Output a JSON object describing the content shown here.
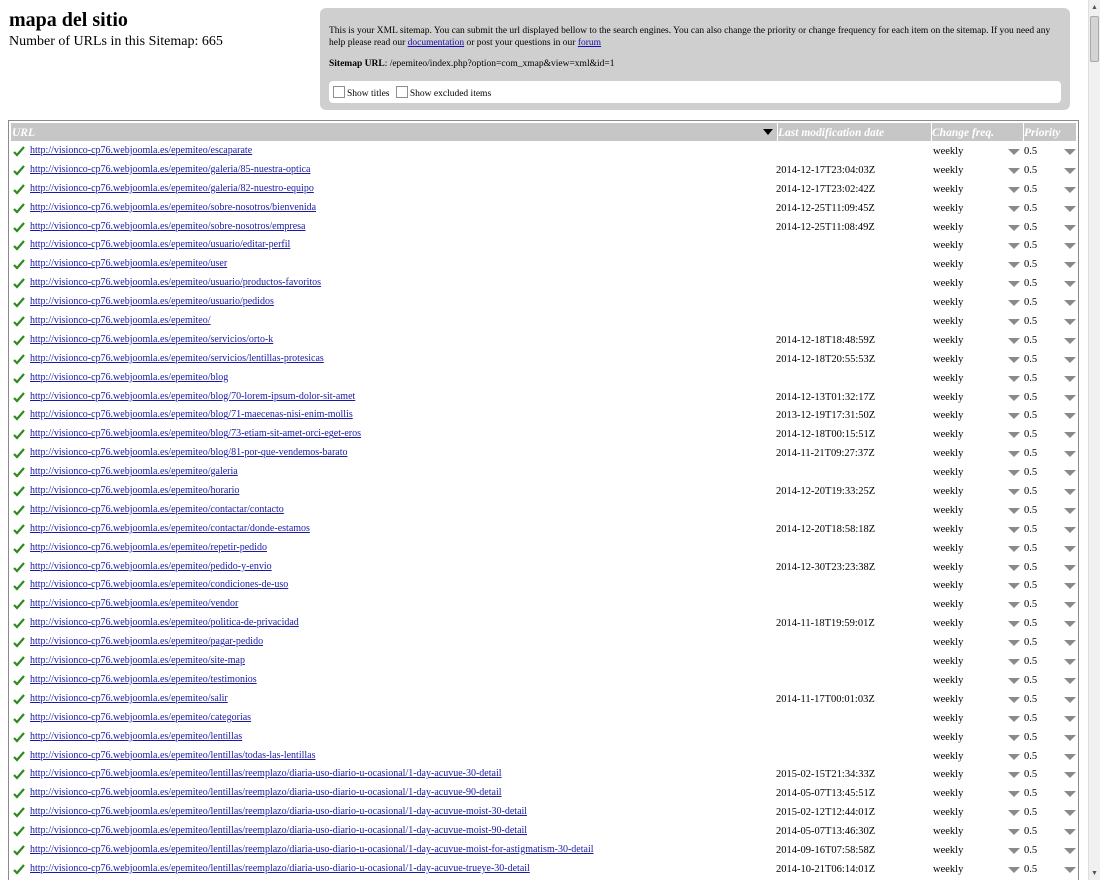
{
  "page": {
    "title": "mapa del sitio",
    "url_count_text": "Number of URLs in this Sitemap: 665"
  },
  "info": {
    "text_before_doc": "This is your XML sitemap. You can submit the url displayed bellow to the search engines. You can also change the priority or change frequency for each item on the sitemap. If you need any help please read our ",
    "documentation_link": "documentation",
    "text_between": " or post your questions in our ",
    "forum_link": "forum",
    "sitemap_url_label": "Sitemap URL",
    "sitemap_url_value": ": /epemiteo/index.php?option=com_xmap&view=xml&id=1",
    "show_titles_label": "Show titles",
    "show_excluded_label": "Show excluded items"
  },
  "table": {
    "headers": {
      "url": "URL",
      "lastmod": "Last modification date",
      "changefreq": "Change freq.",
      "priority": "Priority"
    },
    "rows": [
      {
        "url": "http://visionco-cp76.webjoomla.es/epemiteo/escaparate",
        "lastmod": "",
        "freq": "weekly",
        "prio": "0.5"
      },
      {
        "url": "http://visionco-cp76.webjoomla.es/epemiteo/galeria/85-nuestra-optica",
        "lastmod": "2014-12-17T23:04:03Z",
        "freq": "weekly",
        "prio": "0.5"
      },
      {
        "url": "http://visionco-cp76.webjoomla.es/epemiteo/galeria/82-nuestro-equipo",
        "lastmod": "2014-12-17T23:02:42Z",
        "freq": "weekly",
        "prio": "0.5"
      },
      {
        "url": "http://visionco-cp76.webjoomla.es/epemiteo/sobre-nosotros/bienvenida",
        "lastmod": "2014-12-25T11:09:45Z",
        "freq": "weekly",
        "prio": "0.5"
      },
      {
        "url": "http://visionco-cp76.webjoomla.es/epemiteo/sobre-nosotros/empresa",
        "lastmod": "2014-12-25T11:08:49Z",
        "freq": "weekly",
        "prio": "0.5"
      },
      {
        "url": "http://visionco-cp76.webjoomla.es/epemiteo/usuario/editar-perfil",
        "lastmod": "",
        "freq": "weekly",
        "prio": "0.5"
      },
      {
        "url": "http://visionco-cp76.webjoomla.es/epemiteo/user",
        "lastmod": "",
        "freq": "weekly",
        "prio": "0.5"
      },
      {
        "url": "http://visionco-cp76.webjoomla.es/epemiteo/usuario/productos-favoritos",
        "lastmod": "",
        "freq": "weekly",
        "prio": "0.5"
      },
      {
        "url": "http://visionco-cp76.webjoomla.es/epemiteo/usuario/pedidos",
        "lastmod": "",
        "freq": "weekly",
        "prio": "0.5"
      },
      {
        "url": "http://visionco-cp76.webjoomla.es/epemiteo/",
        "lastmod": "",
        "freq": "weekly",
        "prio": "0.5"
      },
      {
        "url": "http://visionco-cp76.webjoomla.es/epemiteo/servicios/orto-k",
        "lastmod": "2014-12-18T18:48:59Z",
        "freq": "weekly",
        "prio": "0.5"
      },
      {
        "url": "http://visionco-cp76.webjoomla.es/epemiteo/servicios/lentillas-protesicas",
        "lastmod": "2014-12-18T20:55:53Z",
        "freq": "weekly",
        "prio": "0.5"
      },
      {
        "url": "http://visionco-cp76.webjoomla.es/epemiteo/blog",
        "lastmod": "",
        "freq": "weekly",
        "prio": "0.5"
      },
      {
        "url": "http://visionco-cp76.webjoomla.es/epemiteo/blog/70-lorem-ipsum-dolor-sit-amet",
        "lastmod": "2014-12-13T01:32:17Z",
        "freq": "weekly",
        "prio": "0.5"
      },
      {
        "url": "http://visionco-cp76.webjoomla.es/epemiteo/blog/71-maecenas-nisi-enim-mollis",
        "lastmod": "2013-12-19T17:31:50Z",
        "freq": "weekly",
        "prio": "0.5"
      },
      {
        "url": "http://visionco-cp76.webjoomla.es/epemiteo/blog/73-etiam-sit-amet-orci-eget-eros",
        "lastmod": "2014-12-18T00:15:51Z",
        "freq": "weekly",
        "prio": "0.5"
      },
      {
        "url": "http://visionco-cp76.webjoomla.es/epemiteo/blog/81-por-que-vendemos-barato",
        "lastmod": "2014-11-21T09:27:37Z",
        "freq": "weekly",
        "prio": "0.5"
      },
      {
        "url": "http://visionco-cp76.webjoomla.es/epemiteo/galeria",
        "lastmod": "",
        "freq": "weekly",
        "prio": "0.5"
      },
      {
        "url": "http://visionco-cp76.webjoomla.es/epemiteo/horario",
        "lastmod": "2014-12-20T19:33:25Z",
        "freq": "weekly",
        "prio": "0.5"
      },
      {
        "url": "http://visionco-cp76.webjoomla.es/epemiteo/contactar/contacto",
        "lastmod": "",
        "freq": "weekly",
        "prio": "0.5"
      },
      {
        "url": "http://visionco-cp76.webjoomla.es/epemiteo/contactar/donde-estamos",
        "lastmod": "2014-12-20T18:58:18Z",
        "freq": "weekly",
        "prio": "0.5"
      },
      {
        "url": "http://visionco-cp76.webjoomla.es/epemiteo/repetir-pedido",
        "lastmod": "",
        "freq": "weekly",
        "prio": "0.5"
      },
      {
        "url": "http://visionco-cp76.webjoomla.es/epemiteo/pedido-y-envio",
        "lastmod": "2014-12-30T23:23:38Z",
        "freq": "weekly",
        "prio": "0.5"
      },
      {
        "url": "http://visionco-cp76.webjoomla.es/epemiteo/condiciones-de-uso",
        "lastmod": "",
        "freq": "weekly",
        "prio": "0.5"
      },
      {
        "url": "http://visionco-cp76.webjoomla.es/epemiteo/vendor",
        "lastmod": "",
        "freq": "weekly",
        "prio": "0.5"
      },
      {
        "url": "http://visionco-cp76.webjoomla.es/epemiteo/politica-de-privacidad",
        "lastmod": "2014-11-18T19:59:01Z",
        "freq": "weekly",
        "prio": "0.5"
      },
      {
        "url": "http://visionco-cp76.webjoomla.es/epemiteo/pagar-pedido",
        "lastmod": "",
        "freq": "weekly",
        "prio": "0.5"
      },
      {
        "url": "http://visionco-cp76.webjoomla.es/epemiteo/site-map",
        "lastmod": "",
        "freq": "weekly",
        "prio": "0.5"
      },
      {
        "url": "http://visionco-cp76.webjoomla.es/epemiteo/testimonios",
        "lastmod": "",
        "freq": "weekly",
        "prio": "0.5"
      },
      {
        "url": "http://visionco-cp76.webjoomla.es/epemiteo/salir",
        "lastmod": "2014-11-17T00:01:03Z",
        "freq": "weekly",
        "prio": "0.5"
      },
      {
        "url": "http://visionco-cp76.webjoomla.es/epemiteo/categorias",
        "lastmod": "",
        "freq": "weekly",
        "prio": "0.5"
      },
      {
        "url": "http://visionco-cp76.webjoomla.es/epemiteo/lentillas",
        "lastmod": "",
        "freq": "weekly",
        "prio": "0.5"
      },
      {
        "url": "http://visionco-cp76.webjoomla.es/epemiteo/lentillas/todas-las-lentillas",
        "lastmod": "",
        "freq": "weekly",
        "prio": "0.5"
      },
      {
        "url": "http://visionco-cp76.webjoomla.es/epemiteo/lentillas/reemplazo/diaria-uso-diario-u-ocasional/1-day-acuvue-30-detail",
        "lastmod": "2015-02-15T21:34:33Z",
        "freq": "weekly",
        "prio": "0.5"
      },
      {
        "url": "http://visionco-cp76.webjoomla.es/epemiteo/lentillas/reemplazo/diaria-uso-diario-u-ocasional/1-day-acuvue-90-detail",
        "lastmod": "2014-05-07T13:45:51Z",
        "freq": "weekly",
        "prio": "0.5"
      },
      {
        "url": "http://visionco-cp76.webjoomla.es/epemiteo/lentillas/reemplazo/diaria-uso-diario-u-ocasional/1-day-acuvue-moist-30-detail",
        "lastmod": "2015-02-12T12:44:01Z",
        "freq": "weekly",
        "prio": "0.5"
      },
      {
        "url": "http://visionco-cp76.webjoomla.es/epemiteo/lentillas/reemplazo/diaria-uso-diario-u-ocasional/1-day-acuvue-moist-90-detail",
        "lastmod": "2014-05-07T13:46:30Z",
        "freq": "weekly",
        "prio": "0.5"
      },
      {
        "url": "http://visionco-cp76.webjoomla.es/epemiteo/lentillas/reemplazo/diaria-uso-diario-u-ocasional/1-day-acuvue-moist-for-astigmatism-30-detail",
        "lastmod": "2014-09-16T07:58:58Z",
        "freq": "weekly",
        "prio": "0.5"
      },
      {
        "url": "http://visionco-cp76.webjoomla.es/epemiteo/lentillas/reemplazo/diaria-uso-diario-u-ocasional/1-day-acuvue-trueye-30-detail",
        "lastmod": "2014-10-21T06:14:01Z",
        "freq": "weekly",
        "prio": "0.5"
      }
    ]
  },
  "colors": {
    "check": "#2e8b1e",
    "link": "#1a1aa6",
    "header_bg": "#c6c6c6",
    "panel_bg": "#cfcfcf"
  },
  "icons": {
    "row_status": "check-icon",
    "dropdown": "triangle-down-icon"
  }
}
